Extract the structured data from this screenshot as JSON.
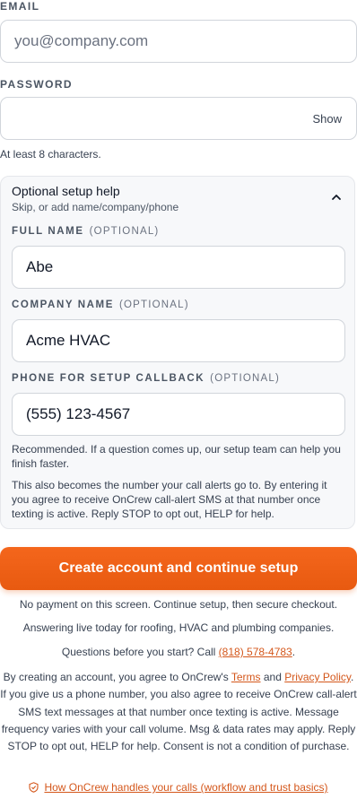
{
  "email": {
    "label": "EMAIL",
    "placeholder": "you@company.com"
  },
  "password": {
    "label": "PASSWORD",
    "show_label": "Show",
    "hint": "At least 8 characters."
  },
  "setup_help": {
    "title": "Optional setup help",
    "subtitle": "Skip, or add name/company/phone",
    "expanded": true,
    "full_name": {
      "label": "FULL NAME",
      "optional": "(OPTIONAL)",
      "value": "Abe"
    },
    "company": {
      "label": "COMPANY NAME",
      "optional": "(OPTIONAL)",
      "value": "Acme HVAC"
    },
    "phone": {
      "label": "PHONE FOR SETUP CALLBACK",
      "optional": "(OPTIONAL)",
      "value": "(555) 123-4567"
    },
    "recommend_text": "Recommended. If a question comes up, our setup team can help you finish faster.",
    "sms_text": "This also becomes the number your call alerts go to. By entering it you agree to receive OnCrew call-alert SMS at that number once texting is active. Reply STOP to opt out, HELP for help."
  },
  "cta": {
    "label": "Create account and continue setup",
    "color": "#ec5f14"
  },
  "notes": {
    "payment": "No payment on this screen. Continue setup, then secure checkout.",
    "live": "Answering live today for roofing, HVAC and plumbing companies.",
    "questions_prefix": "Questions before you start? Call ",
    "questions_phone": "(818) 578-4783",
    "questions_suffix": "."
  },
  "legal": {
    "part1": "By creating an account, you agree to OnCrew's ",
    "terms": "Terms",
    "and": " and ",
    "privacy": "Privacy Policy",
    "part2": ". If you give us a phone number, you also agree to receive OnCrew call-alert SMS text messages at that number once texting is active. Message frequency varies with your call volume. Msg & data rates may apply. Reply STOP to opt out, HELP for help. Consent is not a condition of purchase."
  },
  "trust_link": {
    "icon": "shield-icon",
    "label": "How OnCrew handles your calls (workflow and trust basics)"
  }
}
